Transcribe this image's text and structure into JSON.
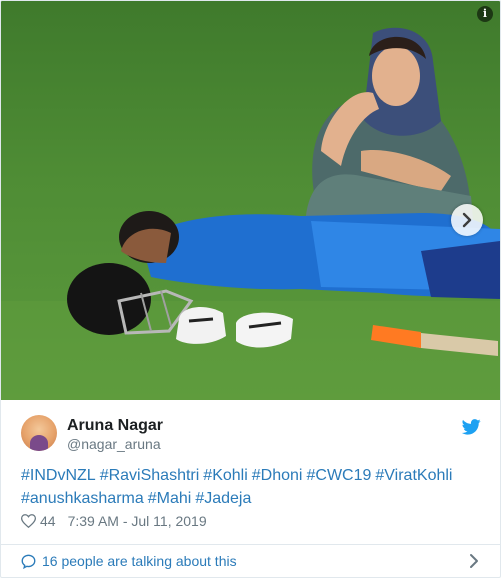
{
  "author": {
    "name": "Aruna Nagar",
    "handle": "@nagar_aruna"
  },
  "tweet": {
    "line1": [
      "#INDvNZL",
      "#RaviShashtri",
      "#Kohli",
      "#Dhoni",
      "#CWC19",
      "#ViratKohli"
    ],
    "line2": [
      "#anushkasharma",
      "#Mahi",
      "#Jadeja"
    ],
    "likes": "44",
    "timestamp": "7:39 AM - Jul 11, 2019"
  },
  "footer": {
    "talking_label": "16 people are talking about this"
  },
  "icons": {
    "info": "info-icon",
    "next": "chevron-right-icon",
    "bird": "twitter-bird-icon",
    "heart": "heart-icon",
    "bubble": "speech-bubble-icon",
    "chevron": "chevron-right-icon"
  },
  "colors": {
    "link": "#2b7bb9",
    "muted": "#697882",
    "twitter_blue": "#1da1f2",
    "text": "#1c2022"
  }
}
